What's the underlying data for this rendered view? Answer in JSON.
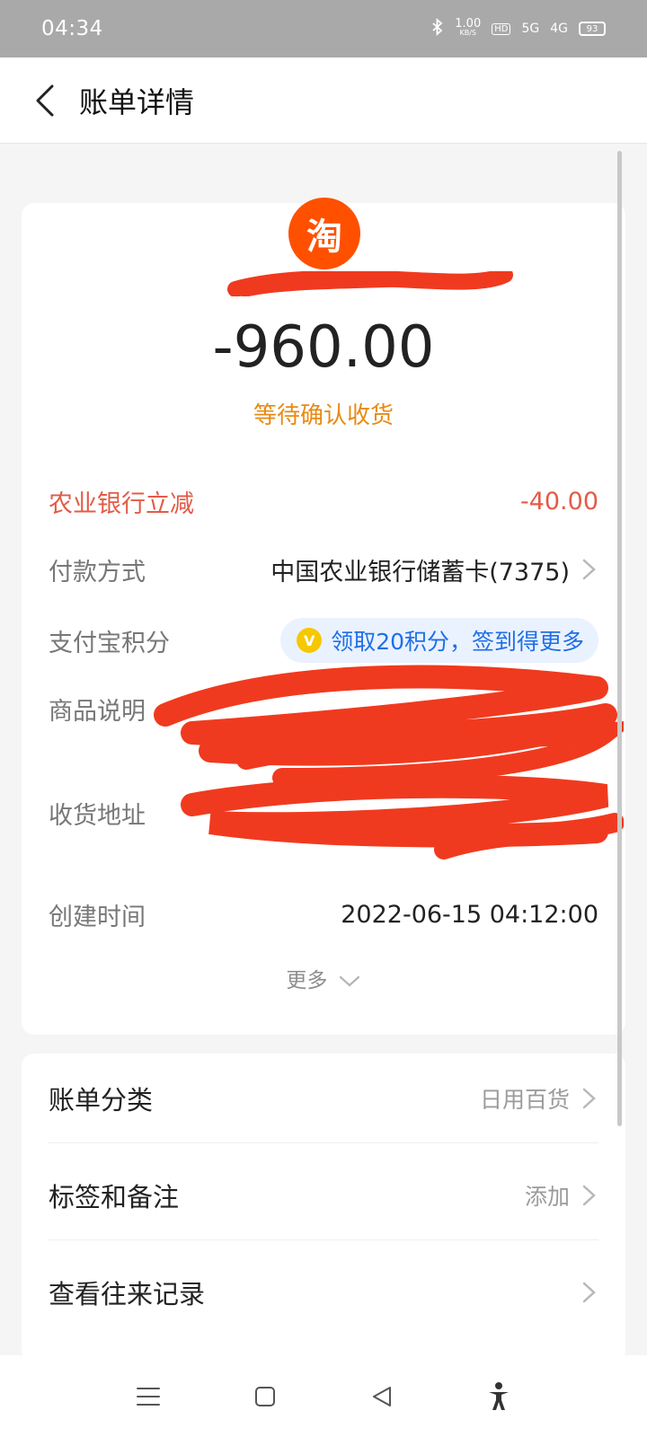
{
  "status_bar": {
    "time": "04:34",
    "network_speed": "1.00",
    "network_speed_unit": "KB/S",
    "hd": "HD",
    "signal_1": "5G",
    "signal_2": "4G",
    "battery": "93"
  },
  "header": {
    "title": "账单详情"
  },
  "bill": {
    "amount": "-960.00",
    "status": "等待确认收货",
    "rows": {
      "discount": {
        "label": "农业银行立减",
        "value": "-40.00"
      },
      "payment": {
        "label": "付款方式",
        "value": "中国农业银行储蓄卡(7375)"
      },
      "points": {
        "label": "支付宝积分",
        "pill": "领取20积分，签到得更多",
        "coin": "V"
      },
      "product": {
        "label": "商品说明"
      },
      "address": {
        "label": "收货地址"
      },
      "created": {
        "label": "创建时间",
        "value": "2022-06-15 04:12:00"
      }
    },
    "more": "更多"
  },
  "list": [
    {
      "label": "账单分类",
      "value": "日用百货"
    },
    {
      "label": "标签和备注",
      "value": "添加"
    },
    {
      "label": "查看往来记录",
      "value": ""
    }
  ],
  "icons": {
    "merchant": "淘"
  },
  "colors": {
    "taobao": "#ff5000",
    "discount": "#e35b47",
    "status": "#e88a13",
    "link": "#1f6fe6",
    "redaction": "#f03a1f"
  }
}
